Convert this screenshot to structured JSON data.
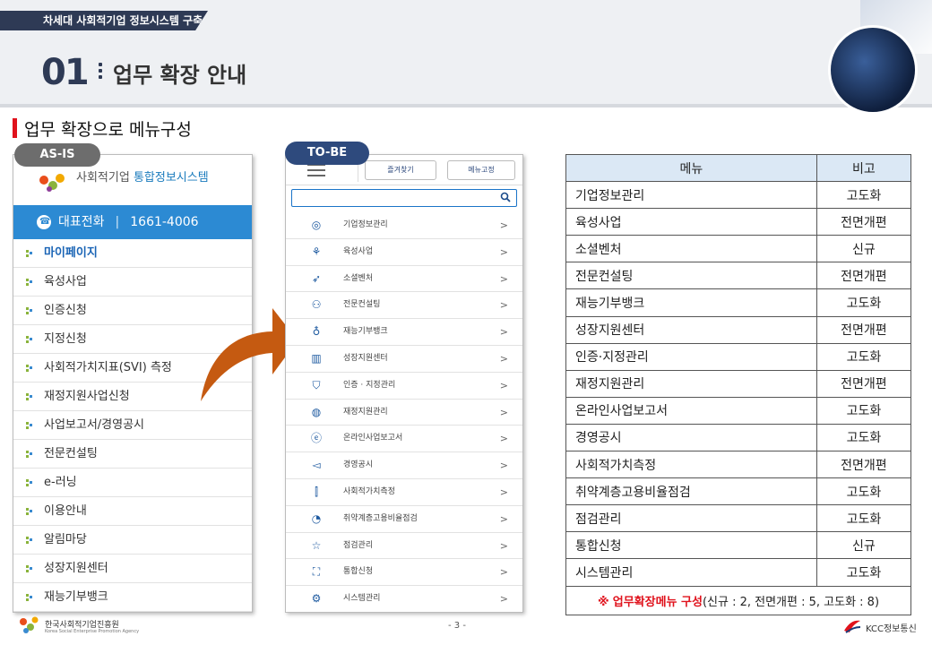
{
  "header": {
    "top_tag": "차세대 사회적기업 정보시스템 구축",
    "section_number": "01",
    "section_title": "업무 확장 안내"
  },
  "subtitle": "업무 확장으로 메뉴구성",
  "asis": {
    "label": "AS-IS",
    "logo_text_prefix": "사회적기업 ",
    "logo_text_highlight": "통합정보시스템",
    "call_label": "대표전화",
    "call_sep": "|",
    "call_number": "1661-4006",
    "menu": [
      "마이페이지",
      "육성사업",
      "인증신청",
      "지정신청",
      "사회적가치지표(SVI) 측정",
      "재정지원사업신청",
      "사업보고서/경영공시",
      "전문컨설팅",
      "e-러닝",
      "이용안내",
      "알림마당",
      "성장지원센터",
      "재능기부뱅크"
    ]
  },
  "tobe": {
    "label": "TO-BE",
    "btn_favorites": "즐겨찾기",
    "btn_fix_menu": "메뉴고정",
    "chevron": ">",
    "menu": [
      {
        "icon": "building-icon",
        "glyph": "◎",
        "label": "기업정보관리"
      },
      {
        "icon": "sprout-icon",
        "glyph": "⚘",
        "label": "육성사업"
      },
      {
        "icon": "rocket-icon",
        "glyph": "➶",
        "label": "소셜벤처"
      },
      {
        "icon": "people-icon",
        "glyph": "⚇",
        "label": "전문컨설팅"
      },
      {
        "icon": "bulb-icon",
        "glyph": "♁",
        "label": "재능기부뱅크"
      },
      {
        "icon": "bar-chart-icon",
        "glyph": "▥",
        "label": "성장지원센터"
      },
      {
        "icon": "shield-icon",
        "glyph": "⛉",
        "label": "인증 · 지정관리"
      },
      {
        "icon": "coins-icon",
        "glyph": "◍",
        "label": "재정지원관리"
      },
      {
        "icon": "e-icon",
        "glyph": "ⓔ",
        "label": "온라인사업보고서"
      },
      {
        "icon": "megaphone-icon",
        "glyph": "◅",
        "label": "경영공시"
      },
      {
        "icon": "line-chart-icon",
        "glyph": "⫿",
        "label": "사회적가치측정"
      },
      {
        "icon": "pie-chart-icon",
        "glyph": "◔",
        "label": "취약계층고용비율점검"
      },
      {
        "icon": "star-icon",
        "glyph": "☆",
        "label": "점검관리"
      },
      {
        "icon": "org-icon",
        "glyph": "⛶",
        "label": "통합신청"
      },
      {
        "icon": "gear-icon",
        "glyph": "⚙",
        "label": "시스템관리"
      }
    ]
  },
  "table": {
    "col_menu": "메뉴",
    "col_note": "비고",
    "rows": [
      {
        "menu": "기업정보관리",
        "note": "고도화"
      },
      {
        "menu": "육성사업",
        "note": "전면개편"
      },
      {
        "menu": "소셜벤처",
        "note": "신규"
      },
      {
        "menu": "전문컨설팅",
        "note": "전면개편"
      },
      {
        "menu": "재능기부뱅크",
        "note": "고도화"
      },
      {
        "menu": "성장지원센터",
        "note": "전면개편"
      },
      {
        "menu": "인증·지정관리",
        "note": "고도화"
      },
      {
        "menu": "재정지원관리",
        "note": "전면개편"
      },
      {
        "menu": "온라인사업보고서",
        "note": "고도화"
      },
      {
        "menu": "경영공시",
        "note": "고도화"
      },
      {
        "menu": "사회적가치측정",
        "note": "전면개편"
      },
      {
        "menu": "취약계층고용비율점검",
        "note": "고도화"
      },
      {
        "menu": "점검관리",
        "note": "고도화"
      },
      {
        "menu": "통합신청",
        "note": "신규"
      },
      {
        "menu": "시스템관리",
        "note": "고도화"
      }
    ],
    "footer_mark": "※",
    "footer_lead": "업무확장메뉴 구성",
    "footer_detail": "(신규 : 2, 전면개편 : 5, 고도화 : 8)"
  },
  "footer": {
    "org_name": "한국사회적기업진흥원",
    "org_name_en": "Korea Social Enterprise Promotion Agency",
    "page": "- 3 -",
    "company": "KCC정보통신"
  },
  "colors": {
    "navy": "#2e3a55",
    "accent_red": "#e0121c",
    "call_blue": "#2c8ad3",
    "arrow_orange": "#c55a11",
    "table_header": "#dbe8f5"
  }
}
